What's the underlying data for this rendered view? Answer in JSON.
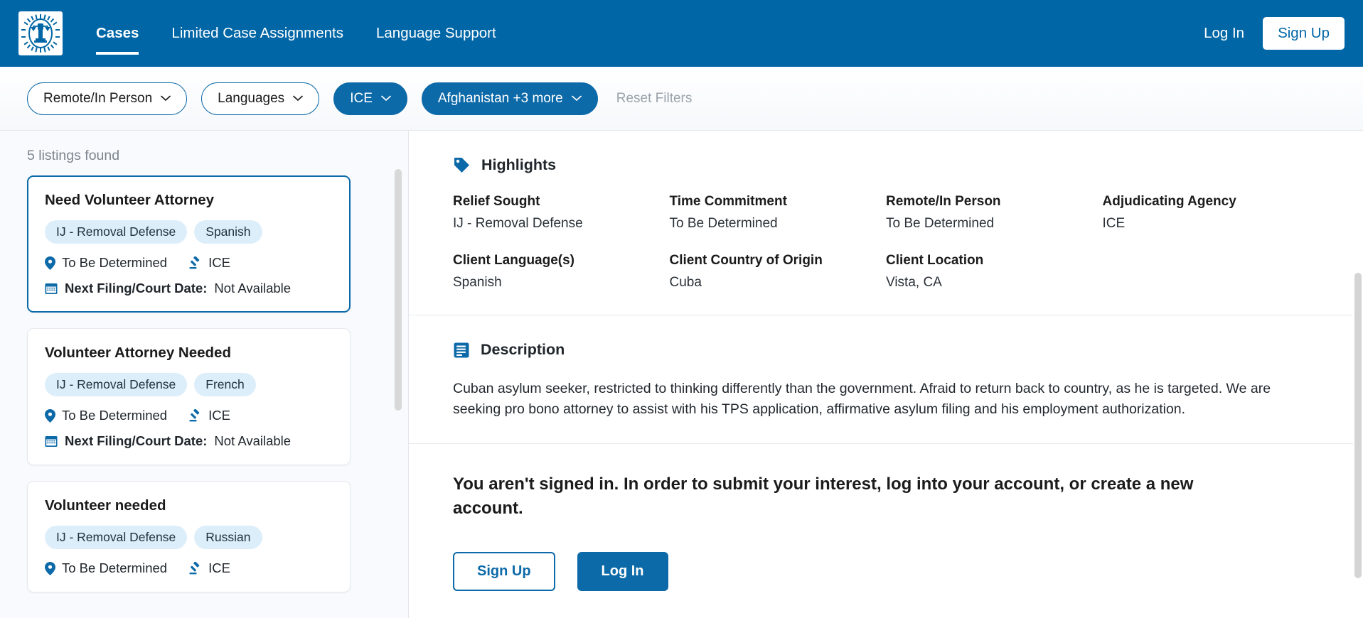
{
  "colors": {
    "brand_blue": "#0066a6",
    "accent_blue": "#0d6aa8",
    "tag_bg": "#ddeefb",
    "muted_text": "#7d858e"
  },
  "header": {
    "logo_name": "scales-of-justice-badge-logo",
    "nav": [
      {
        "label": "Cases",
        "active": true
      },
      {
        "label": "Limited Case Assignments",
        "active": false
      },
      {
        "label": "Language Support",
        "active": false
      }
    ],
    "login_label": "Log In",
    "signup_label": "Sign Up"
  },
  "filters": {
    "chips": [
      {
        "label": "Remote/In Person",
        "style": "outline"
      },
      {
        "label": "Languages",
        "style": "outline"
      },
      {
        "label": "ICE",
        "style": "filled"
      },
      {
        "label": "Afghanistan +3 more",
        "style": "filled"
      }
    ],
    "reset_label": "Reset Filters"
  },
  "sidebar": {
    "count_label": "5 listings found",
    "cards": [
      {
        "title": "Need Volunteer Attorney",
        "tags": [
          "IJ - Removal Defense",
          "Spanish"
        ],
        "location": "To Be Determined",
        "agency": "ICE",
        "next_date_label": "Next Filing/Court Date:",
        "next_date_value": "Not Available",
        "selected": true
      },
      {
        "title": "Volunteer Attorney Needed",
        "tags": [
          "IJ - Removal Defense",
          "French"
        ],
        "location": "To Be Determined",
        "agency": "ICE",
        "next_date_label": "Next Filing/Court Date:",
        "next_date_value": "Not Available",
        "selected": false
      },
      {
        "title": "Volunteer needed",
        "tags": [
          "IJ - Removal Defense",
          "Russian"
        ],
        "location": "To Be Determined",
        "agency": "ICE",
        "next_date_label": "",
        "next_date_value": "",
        "selected": false
      }
    ]
  },
  "main": {
    "highlights": {
      "title": "Highlights",
      "icon": "tag-icon",
      "fields": [
        {
          "label": "Relief Sought",
          "value": "IJ - Removal Defense"
        },
        {
          "label": "Time Commitment",
          "value": "To Be Determined"
        },
        {
          "label": "Remote/In Person",
          "value": "To Be Determined"
        },
        {
          "label": "Adjudicating Agency",
          "value": "ICE"
        },
        {
          "label": "Client Language(s)",
          "value": "Spanish"
        },
        {
          "label": "Client Country of Origin",
          "value": "Cuba"
        },
        {
          "label": "Client Location",
          "value": "Vista, CA"
        },
        {
          "label": "",
          "value": ""
        }
      ]
    },
    "description": {
      "title": "Description",
      "icon": "document-icon",
      "text": "Cuban asylum seeker, restricted to thinking differently than the government. Afraid to return back to country, as he is targeted. We are seeking pro bono attorney to assist with his TPS application, affirmative asylum filing and his employment authorization."
    },
    "signin": {
      "message": "You aren't signed in. In order to submit your interest, log into your account, or create a new account.",
      "signup_label": "Sign Up",
      "login_label": "Log In"
    }
  }
}
